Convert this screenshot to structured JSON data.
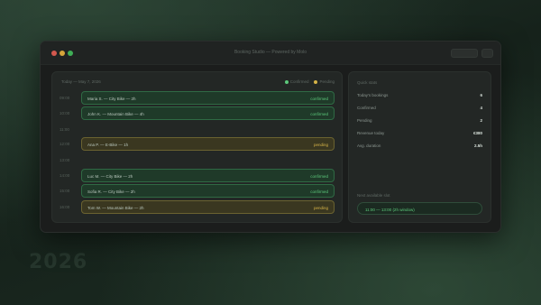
{
  "window": {
    "title": "Booking Studio — Powered by Molo",
    "controls": [
      "close",
      "minimize",
      "maximize"
    ]
  },
  "colors": {
    "confirmed": "#5cc97b",
    "pending": "#d5b347",
    "window_bg": "#1b1d1c"
  },
  "schedule": {
    "date": "Today — May 7, 2026",
    "legend": [
      {
        "label": "Confirmed",
        "color": "#5cc97b"
      },
      {
        "label": "Pending",
        "color": "#d5b347"
      }
    ],
    "slots": [
      {
        "time": "09:00",
        "booking": {
          "label": "Maria S. — City Bike — 2h",
          "status": "confirmed"
        }
      },
      {
        "time": "10:00",
        "booking": {
          "label": "John K. — Mountain Bike — 4h",
          "status": "confirmed"
        }
      },
      {
        "time": "11:00",
        "booking": null
      },
      {
        "time": "12:00",
        "booking": {
          "label": "Ana P. — E-Bike — 1h",
          "status": "pending"
        }
      },
      {
        "time": "13:00",
        "booking": null
      },
      {
        "time": "14:00",
        "booking": {
          "label": "Luc M. — City Bike — 2h",
          "status": "confirmed"
        }
      },
      {
        "time": "15:00",
        "booking": {
          "label": "Sofia R. — City Bike — 2h",
          "status": "confirmed"
        }
      },
      {
        "time": "16:00",
        "booking": {
          "label": "Tom W. — Mountain Bike — 2h",
          "status": "pending"
        }
      }
    ]
  },
  "stats": {
    "title": "Quick stats",
    "rows": [
      {
        "label": "Today's bookings",
        "value": "6"
      },
      {
        "label": "Confirmed",
        "value": "4"
      },
      {
        "label": "Pending",
        "value": "2"
      },
      {
        "label": "Revenue today",
        "value": "€380"
      },
      {
        "label": "Avg. duration",
        "value": "2.5h"
      }
    ],
    "next_title": "Next available slot",
    "next_value": "11:00 — 13:00 (2h window)"
  },
  "background": {
    "year": "2026"
  }
}
